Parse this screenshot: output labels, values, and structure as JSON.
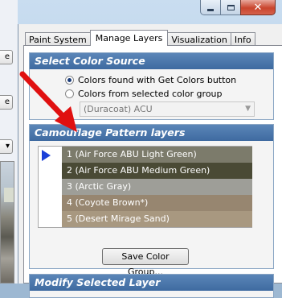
{
  "left_panel": {
    "button1_label": "e",
    "button2_label": "e",
    "dropdown_arrow": "▾"
  },
  "window": {
    "controls": {
      "minimize": "–",
      "maximize": "□",
      "close": "✕"
    }
  },
  "tabs": [
    {
      "label": "Paint System"
    },
    {
      "label": "Manage Layers"
    },
    {
      "label": "Visualization"
    },
    {
      "label": "Info"
    }
  ],
  "select_color_source": {
    "header": "Select Color Source",
    "radio_get_colors": "Colors found with Get Colors button",
    "radio_color_group": "Colors from selected color group",
    "color_group_value": "(Duracoat) ACU"
  },
  "camouflage_layers": {
    "header": "Camouflage Pattern layers",
    "items": [
      {
        "label": "1 (Air Force ABU Light Green)",
        "color": "#7c7b6b"
      },
      {
        "label": "2 (Air Force ABU Medium Green)",
        "color": "#4a4a35"
      },
      {
        "label": "3 (Arctic Gray)",
        "color": "#9e9e98"
      },
      {
        "label": "4 (Coyote Brown*)",
        "color": "#978670"
      },
      {
        "label": "5 (Desert Mirage Sand)",
        "color": "#a89880"
      }
    ],
    "save_button": "Save Color Group..."
  },
  "modify_layer": {
    "header": "Modify Selected Layer"
  },
  "colors": {
    "accent_header": "#4a76ac",
    "arrow": "#e01010",
    "pointer": "#1a3fd8"
  }
}
